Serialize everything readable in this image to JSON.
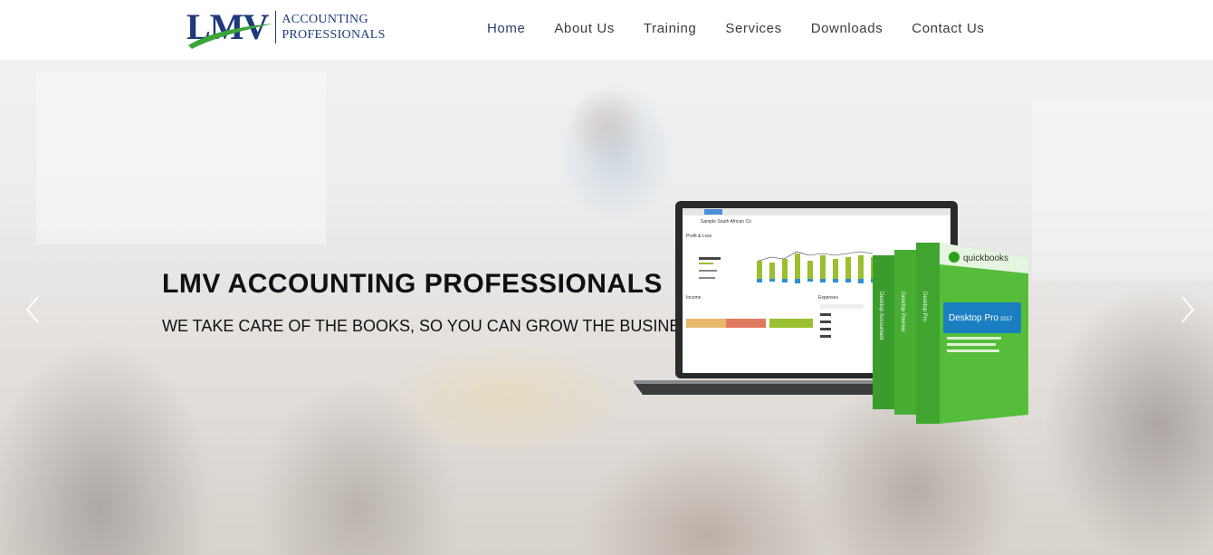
{
  "header": {
    "logo": {
      "mark": "LMV",
      "line1": "ACCOUNTING",
      "line2": "PROFESSIONALS"
    },
    "nav": [
      {
        "label": "Home",
        "active": true
      },
      {
        "label": "About Us",
        "active": false
      },
      {
        "label": "Training",
        "active": false
      },
      {
        "label": "Services",
        "active": false
      },
      {
        "label": "Downloads",
        "active": false
      },
      {
        "label": "Contact Us",
        "active": false
      }
    ],
    "search_icon": "search-icon"
  },
  "hero": {
    "title": "LMV ACCOUNTING PROFESSIONALS",
    "subtitle": "WE TAKE CARE OF THE BOOKS, SO YOU CAN GROW THE BUSINESS",
    "prev_icon": "chevron-left-icon",
    "next_icon": "chevron-right-icon"
  },
  "product_image": {
    "laptop_screen": {
      "company": "Sample South African Co",
      "panel": "Profit & Loss",
      "income_label": "Income",
      "expenses_label": "Expenses"
    },
    "box": {
      "brand": "quickbooks",
      "product": "Desktop Pro",
      "year": "2017",
      "side_labels": [
        "Desktop Accountant",
        "Desktop Premier",
        "Desktop Pro"
      ]
    }
  },
  "colors": {
    "brand_blue": "#1f3a7a",
    "brand_green": "#3aa53a",
    "nav_text": "#3b3b3b",
    "hero_text": "#111111"
  }
}
